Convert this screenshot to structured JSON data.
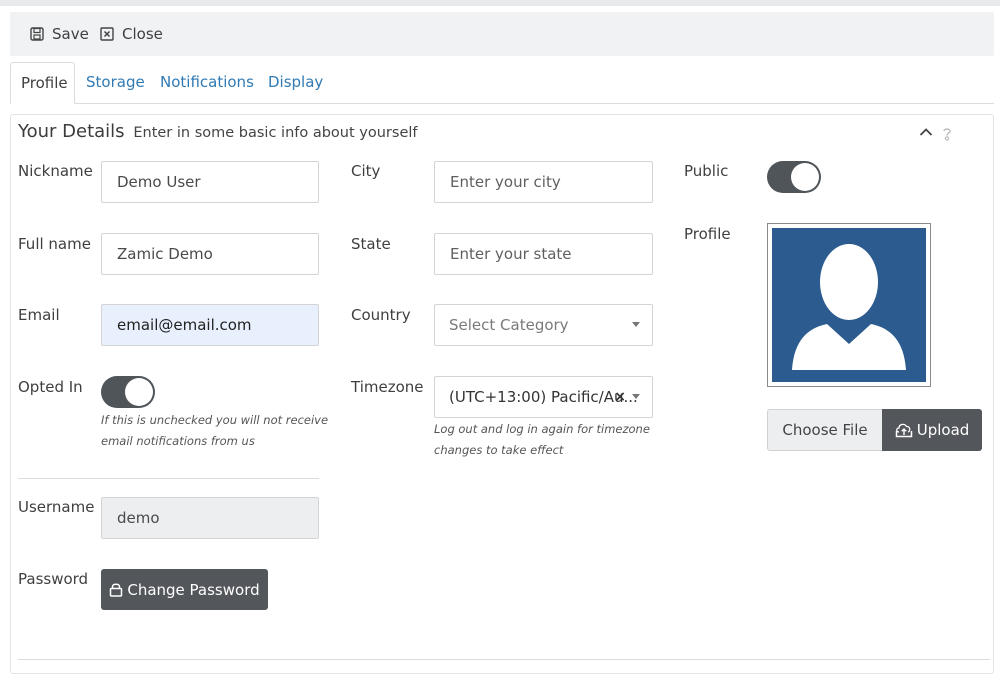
{
  "toolbar": {
    "save_label": "Save",
    "close_label": "Close"
  },
  "tabs": [
    {
      "label": "Profile",
      "active": true
    },
    {
      "label": "Storage",
      "active": false
    },
    {
      "label": "Notifications",
      "active": false
    },
    {
      "label": "Display",
      "active": false
    }
  ],
  "panel": {
    "title": "Your Details",
    "subtitle": "Enter in some basic info about yourself"
  },
  "form": {
    "nickname": {
      "label": "Nickname",
      "value": "Demo User"
    },
    "fullname": {
      "label": "Full name",
      "value": "Zamic Demo"
    },
    "email": {
      "label": "Email",
      "value": "email@email.com"
    },
    "opted_in": {
      "label": "Opted In",
      "checked": true,
      "hint_line1": "If this is unchecked you will not receive",
      "hint_line2": "email notifications from us"
    },
    "username": {
      "label": "Username",
      "value": "demo"
    },
    "password": {
      "label": "Password",
      "button": "Change Password"
    },
    "city": {
      "label": "City",
      "placeholder": "Enter your city"
    },
    "state": {
      "label": "State",
      "placeholder": "Enter your state"
    },
    "country": {
      "label": "Country",
      "placeholder": "Select Category"
    },
    "timezone": {
      "label": "Timezone",
      "value": "(UTC+13:00) Pacific/Au...",
      "clear": "×",
      "hint_line1": "Log out and log in again for timezone",
      "hint_line2": "changes to take effect"
    },
    "public": {
      "label": "Public",
      "checked": true
    },
    "profile": {
      "label": "Profile",
      "choose_label": "Choose File",
      "upload_label": "Upload"
    }
  },
  "colors": {
    "link": "#2f7ab4",
    "toggle": "#50555a",
    "dark_button": "#53575b",
    "avatar_bg": "#2c5c8f",
    "email_bg": "#e8f0fe"
  }
}
